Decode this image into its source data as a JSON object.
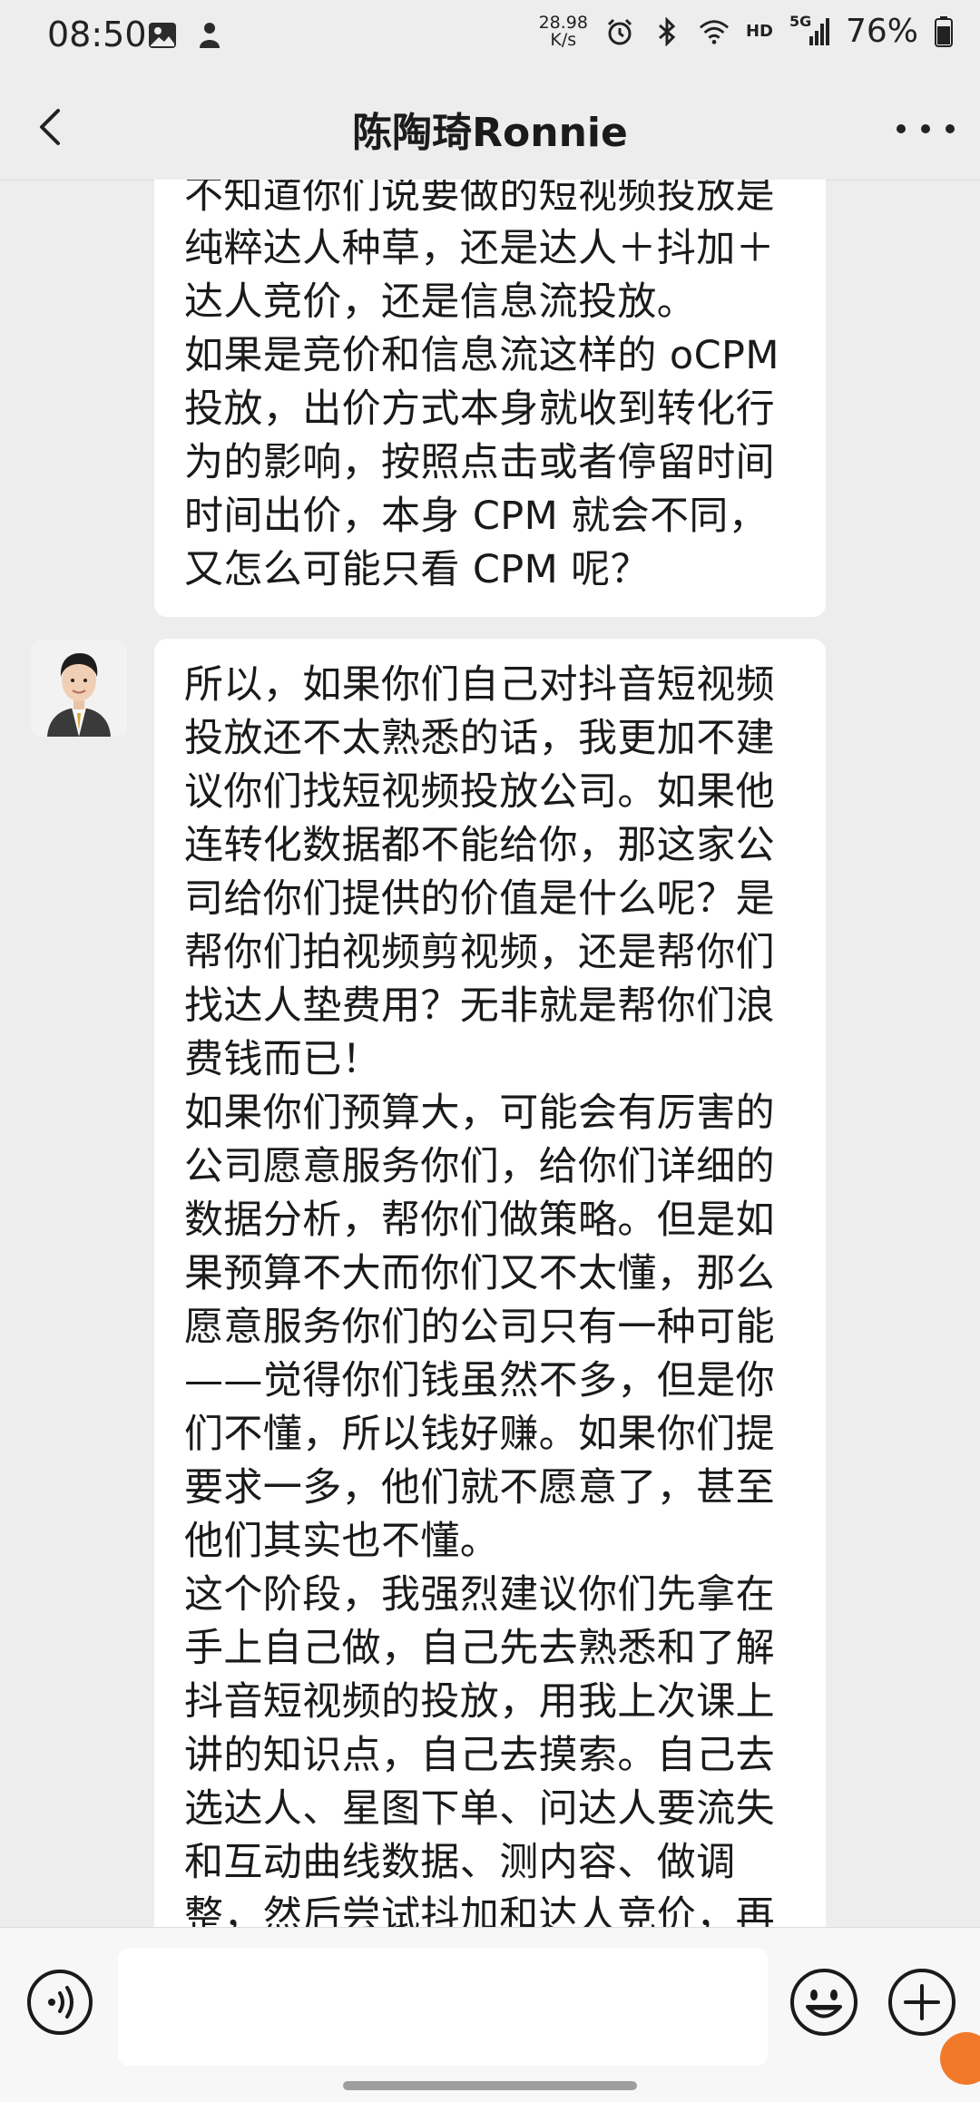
{
  "status_bar": {
    "time": "08:50",
    "net_speed_value": "28.98",
    "net_speed_unit": "K/s",
    "network_label": "HD",
    "cell_label": "5G",
    "battery": "76%"
  },
  "header": {
    "title": "陈陶琦Ronnie"
  },
  "messages": [
    {
      "paragraphs": [
        "不知道你们说要做的短视频投放是纯粹达人种草，还是达人＋抖加＋达人竞价，还是信息流投放。",
        "如果是竞价和信息流这样的 oCPM 投放，出价方式本身就收到转化行为的影响，按照点击或者停留时间时间出价，本身 CPM 就会不同，又怎么可能只看 CPM 呢？"
      ]
    },
    {
      "paragraphs": [
        "所以，如果你们自己对抖音短视频投放还不太熟悉的话，我更加不建议你们找短视频投放公司。如果他连转化数据都不能给你，那这家公司给你们提供的价值是什么呢？是帮你们拍视频剪视频，还是帮你们找达人垫费用？无非就是帮你们浪费钱而已！",
        "如果你们预算大，可能会有厉害的公司愿意服务你们，给你们详细的数据分析，帮你们做策略。但是如果预算不大而你们又不太懂，那么愿意服务你们的公司只有一种可能——觉得你们钱虽然不多，但是你们不懂，所以钱好赚。如果你们提要求一多，他们就不愿意了，甚至他们其实也不懂。",
        "这个阶段，我强烈建议你们先拿在手上自己做，自己先去熟悉和了解抖音短视频的投放，用我上次课上讲的知识点，自己去摸索。自己去选达人、星图下单、问达人要流失和互动曲线数据、测内容、做调整，然后尝试抖加和达人竞价，再尝试"
      ]
    }
  ],
  "input": {
    "value": ""
  },
  "icons": {
    "back": "chevron-left-icon",
    "more": "more-dots-icon",
    "voice": "voice-icon",
    "emoji": "emoji-icon",
    "plus": "plus-icon"
  }
}
